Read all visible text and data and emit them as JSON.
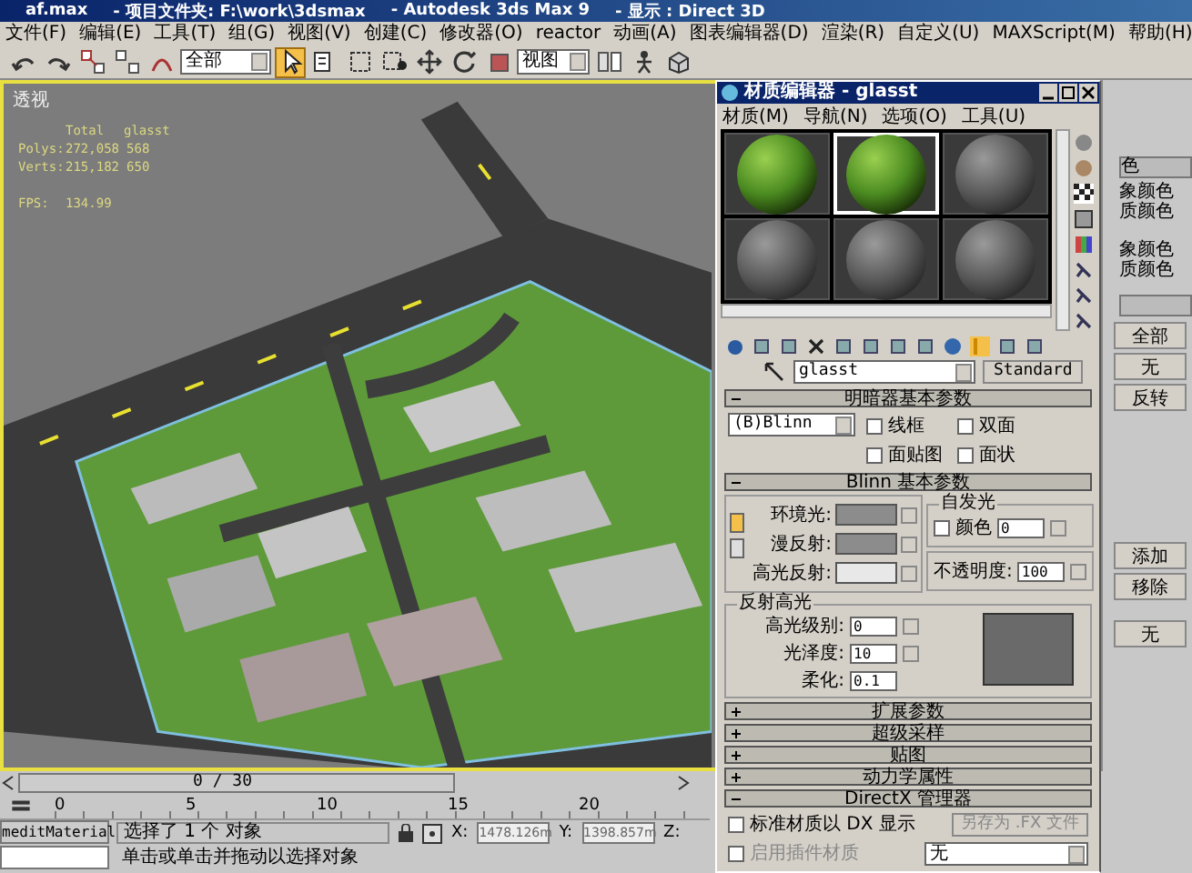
{
  "window": {
    "title_parts": [
      "af.max",
      "- 项目文件夹: F:\\work\\3dsmax",
      "- Autodesk 3ds Max 9",
      "- 显示 : Direct 3D"
    ]
  },
  "menu": [
    "文件(F)",
    "编辑(E)",
    "工具(T)",
    "组(G)",
    "视图(V)",
    "创建(C)",
    "修改器(O)",
    "reactor",
    "动画(A)",
    "图表编辑器(D)",
    "渲染(R)",
    "自定义(U)",
    "MAXScript(M)",
    "帮助(H)"
  ],
  "toolbar": {
    "filter": "全部",
    "reference": "视图",
    "tools": [
      {
        "kind": "undo"
      },
      {
        "kind": "redo"
      },
      {
        "kind": "link"
      },
      {
        "kind": "unlink"
      },
      {
        "kind": "bind"
      },
      {
        "kind": "filter"
      },
      {
        "kind": "select",
        "selected": true
      },
      {
        "kind": "list"
      },
      {
        "kind": "region"
      },
      {
        "kind": "crossing"
      },
      {
        "kind": "move",
        "selected": false
      },
      {
        "kind": "rotate",
        "selected": false
      },
      {
        "kind": "scale",
        "selected": false
      },
      {
        "kind": "reference"
      },
      {
        "kind": "pivot"
      },
      {
        "kind": "figure"
      },
      {
        "kind": "box"
      }
    ]
  },
  "viewport": {
    "label": "透视",
    "total_heading": "Total",
    "object_heading": "glasst",
    "stats": [
      {
        "label": "Polys:",
        "total": "272,058",
        "object": "568"
      },
      {
        "label": "Verts:",
        "total": "215,182",
        "object": "650"
      }
    ],
    "fps_label": "FPS:",
    "fps": "134.99"
  },
  "command_panel": {
    "header": "色",
    "lines": [
      "象颜色",
      "质颜色",
      "象颜色",
      "质颜色"
    ],
    "buttons": [
      "全部",
      "无",
      "反转"
    ],
    "buttons_2": [
      "添加",
      "移除",
      "无"
    ]
  },
  "material_editor": {
    "title": "材质编辑器 - glasst",
    "menu": [
      "材质(M)",
      "导航(N)",
      "选项(O)",
      "工具(U)"
    ],
    "slots": [
      {
        "kind": "grass",
        "selected": false
      },
      {
        "kind": "grass",
        "selected": true
      },
      {
        "kind": "gray",
        "selected": false
      },
      {
        "kind": "gray",
        "selected": false
      },
      {
        "kind": "gray",
        "selected": false
      },
      {
        "kind": "gray",
        "selected": false
      }
    ],
    "material_name": "glasst",
    "material_type": "Standard",
    "rollouts": [
      {
        "kind": "shader",
        "title": "明暗器基本参数",
        "expanded": true,
        "shader": "(B)Blinn",
        "options": [
          {
            "label": "线框",
            "checked": false
          },
          {
            "label": "双面",
            "checked": false
          },
          {
            "label": "面贴图",
            "checked": false
          },
          {
            "label": "面状",
            "checked": false
          }
        ]
      },
      {
        "kind": "blinn",
        "title": "Blinn 基本参数",
        "expanded": true,
        "colors": [
          {
            "label": "环境光:",
            "color": "#8c8c8c"
          },
          {
            "label": "漫反射:",
            "color": "#8c8c8c"
          },
          {
            "label": "高光反射:",
            "color": "#e8e8e8"
          }
        ],
        "self_illum": {
          "title": "自发光",
          "label": "颜色",
          "checked": false,
          "value": "0"
        },
        "opacity_label": "不透明度:",
        "opacity": "100",
        "highlights": {
          "title": "反射高光",
          "fields": [
            {
              "label": "高光级别:",
              "value": "0"
            },
            {
              "label": "光泽度:",
              "value": "10"
            },
            {
              "label": "柔化:",
              "value": "0.1"
            }
          ]
        }
      },
      {
        "kind": "plain",
        "title": "扩展参数",
        "expanded": false
      },
      {
        "kind": "plain",
        "title": "超级采样",
        "expanded": false
      },
      {
        "kind": "plain",
        "title": "贴图",
        "expanded": false
      },
      {
        "kind": "plain",
        "title": "动力学属性",
        "expanded": false
      },
      {
        "kind": "directx",
        "title": "DirectX 管理器",
        "expanded": true,
        "dx_label": "标准材质以 DX 显示",
        "dx_checked": false,
        "save_button": "另存为 .FX 文件",
        "plugin_label": "启用插件材质",
        "plugin_checked": false,
        "plugin_value": "无"
      }
    ]
  },
  "timeline": {
    "frame": "0 / 30",
    "level": 0,
    "ticks": [
      "0",
      "5",
      "10",
      "15",
      "20"
    ]
  },
  "status": {
    "script_field": "meditMaterial",
    "selection": "选择了 1 个 对象",
    "x_label": "X:",
    "x": "1478.126m",
    "y_label": "Y:",
    "y": "1398.857m",
    "z_label": "Z:",
    "prompt": "单击或单击并拖动以选择对象"
  }
}
